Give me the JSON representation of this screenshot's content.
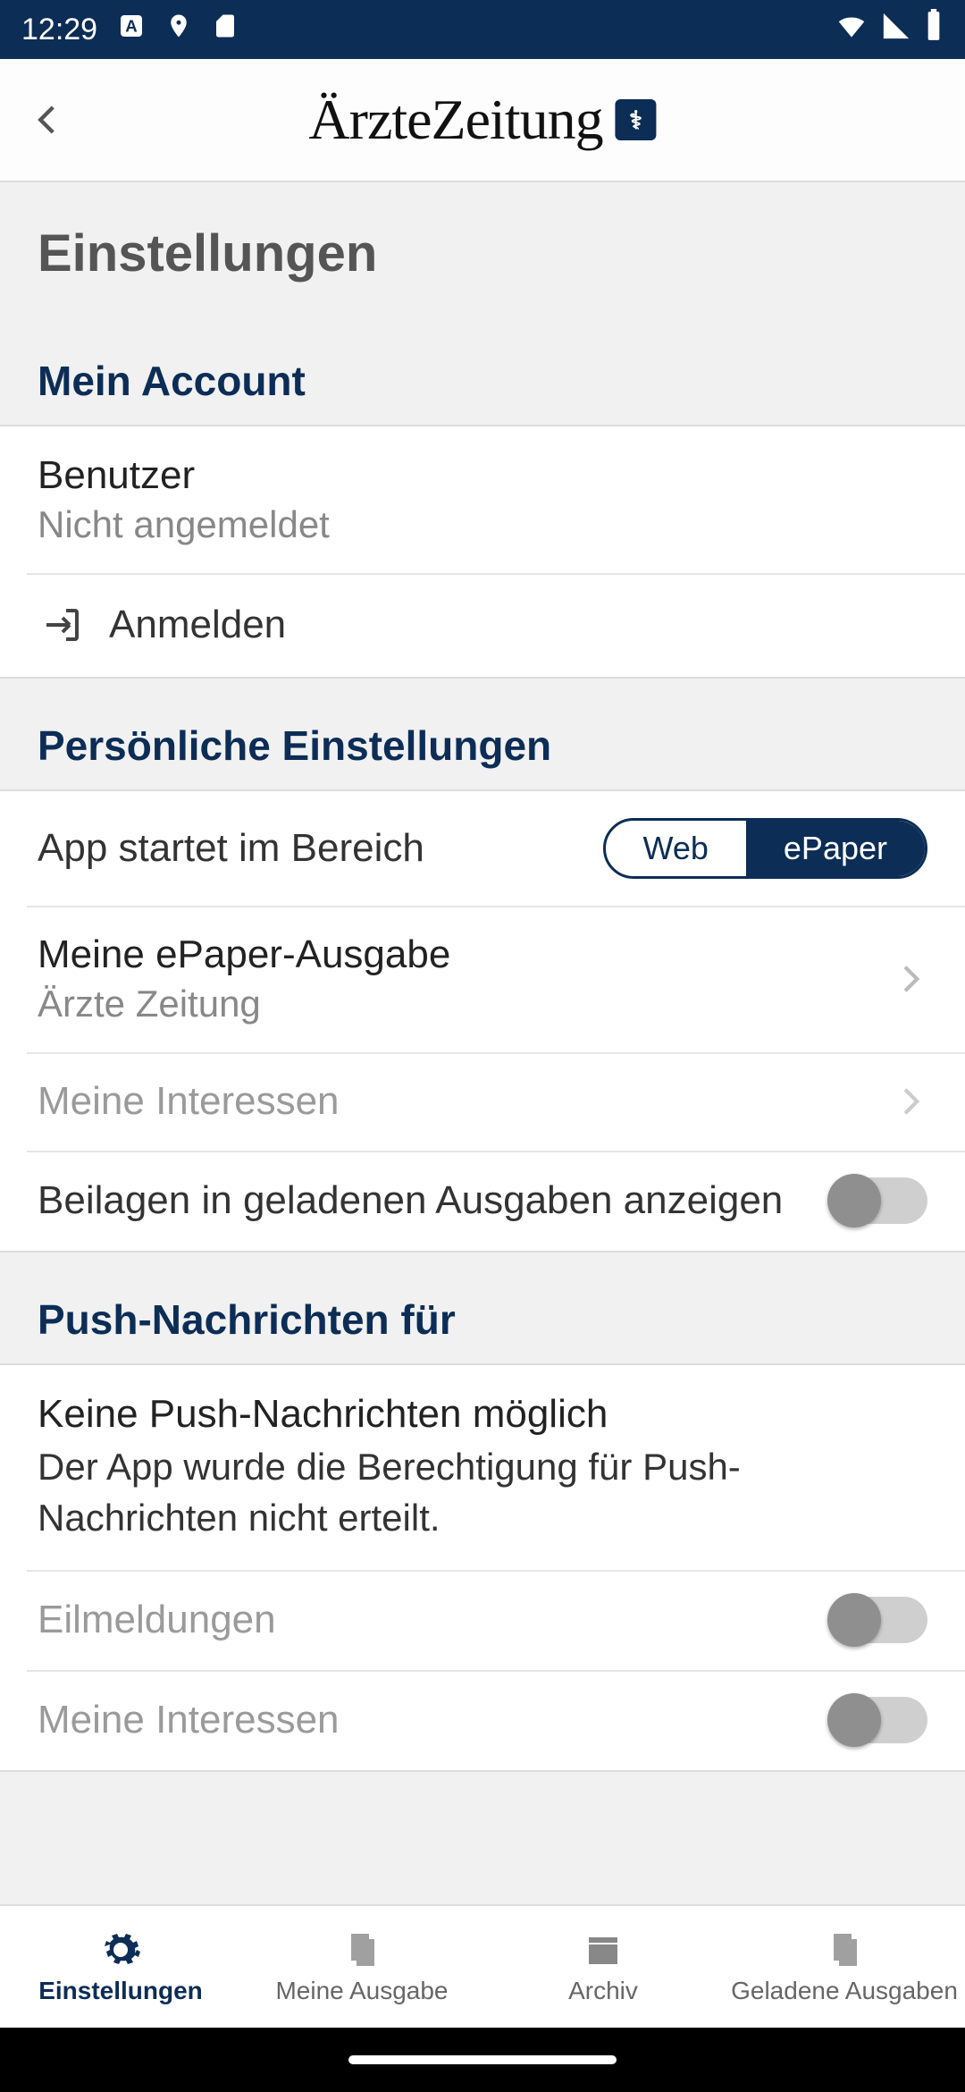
{
  "statusbar": {
    "time": "12:29"
  },
  "header": {
    "logo_text": "ÄrzteZeitung",
    "logo_badge": "⚕"
  },
  "page_title": "Einstellungen",
  "section_account": {
    "header": "Mein Account",
    "user_label": "Benutzer",
    "user_status": "Nicht angemeldet",
    "login_label": "Anmelden"
  },
  "section_personal": {
    "header": "Persönliche Einstellungen",
    "start_area_label": "App startet im Bereich",
    "segment": {
      "web": "Web",
      "epaper": "ePaper"
    },
    "epaper_edition_label": "Meine ePaper-Ausgabe",
    "epaper_edition_value": "Ärzte Zeitung",
    "interests_label": "Meine Interessen",
    "attachments_label": "Beilagen in geladenen Ausgaben anzeigen"
  },
  "section_push": {
    "header": "Push-Nachrichten für",
    "no_push_title": "Keine Push-Nachrichten möglich",
    "no_push_body": "Der App wurde die Berechtigung für Push-Nachrichten nicht erteilt.",
    "breaking_label": "Eilmeldungen",
    "interests_label": "Meine Interessen"
  },
  "tabs": {
    "settings": "Einstellungen",
    "my_issue": "Meine Ausgabe",
    "archive": "Archiv",
    "loaded": "Geladene Ausgaben"
  }
}
